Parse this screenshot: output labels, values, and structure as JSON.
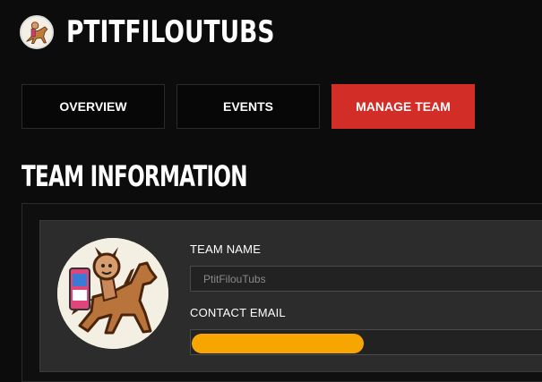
{
  "header": {
    "team_name": "PTITFILOUTUBS",
    "logo_icon": "horse-rider-logo-icon"
  },
  "tabs": [
    {
      "label": "OVERVIEW",
      "active": false
    },
    {
      "label": "EVENTS",
      "active": false
    },
    {
      "label": "MANAGE TEAM",
      "active": true
    }
  ],
  "section": {
    "title": "TEAM INFORMATION"
  },
  "form": {
    "team_name_label": "TEAM NAME",
    "team_name_value": "PtitFilouTubs",
    "contact_email_label": "CONTACT EMAIL",
    "contact_email_value": ""
  },
  "colors": {
    "accent": "#d32d27",
    "redaction": "#f7a500"
  }
}
